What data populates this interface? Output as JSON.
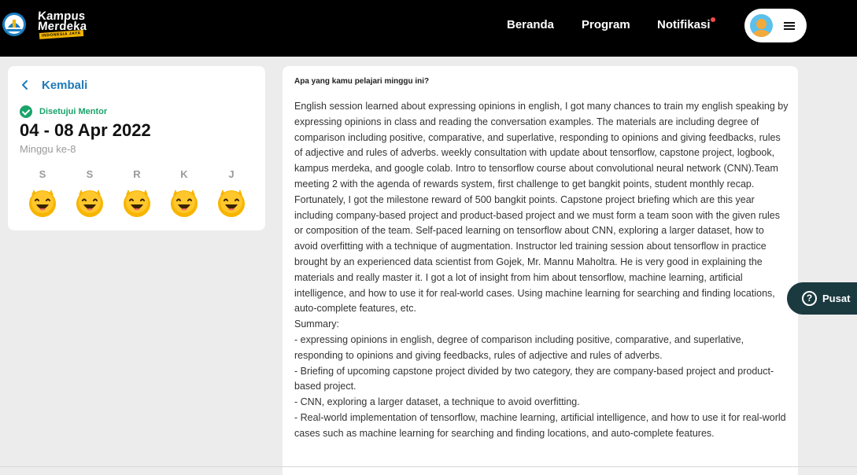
{
  "header": {
    "logo": {
      "word1": "Kampus",
      "word2": "Merdeka",
      "tagline": "INDONESIA JAYA"
    },
    "nav": {
      "beranda": "Beranda",
      "program": "Program",
      "notifikasi": "Notifikasi"
    },
    "colors": {
      "background": "#000000",
      "notif_dot": "#ff4a4a"
    }
  },
  "left_card": {
    "back_label": "Kembali",
    "status": "Disetujui Mentor",
    "date_range": "04 - 08 Apr 2022",
    "week": "Minggu ke-8",
    "days": [
      {
        "letter": "S",
        "mood": "very-happy-emoji"
      },
      {
        "letter": "S",
        "mood": "very-happy-emoji"
      },
      {
        "letter": "R",
        "mood": "very-happy-emoji"
      },
      {
        "letter": "K",
        "mood": "very-happy-emoji"
      },
      {
        "letter": "J",
        "mood": "very-happy-emoji"
      }
    ],
    "colors": {
      "accent": "#1f7bb6",
      "approved": "#1aa36a",
      "emoji": "#f7b500"
    }
  },
  "content": {
    "question": "Apa yang kamu pelajari minggu ini?",
    "paragraph": "English session learned about expressing opinions in english, I got many chances to train my english speaking by expressing opinions in class and reading the conversation examples. The materials are including degree of comparison including positive, comparative, and superlative, responding to opinions and giving feedbacks, rules of adjective and rules of adverbs. weekly consultation with update about tensorflow, capstone project, logbook, kampus merdeka, and google colab. Intro to tensorflow course about convolutional neural network (CNN).Team meeting 2 with the agenda of rewards system, first challenge to get bangkit points, student monthly recap. Fortunately, I got the milestone reward of 500 bangkit points. Capstone project briefing which are this year including company-based project and product-based project and we must form a team soon with the given rules or composition of the team. Self-paced learning on tensorflow about CNN, exploring a larger dataset, how to avoid overfitting with a technique of augmentation. Instructor led training session about tensorflow in practice brought by an experienced data scientist from Gojek, Mr. Mannu Maholtra. He is very good in explaining the materials and really master it. I got a lot of insight from him about tensorflow, machine learning, artificial intelligence, and how to use it for real-world cases. Using machine learning for searching and finding locations, auto-complete features, etc.",
    "summary_heading": "Summary:",
    "summary_items": [
      "-    expressing opinions in english, degree of comparison including positive, comparative, and superlative, responding to opinions and giving feedbacks, rules of adjective and rules of adverbs.",
      "-    Briefing of upcoming capstone project divided by two category, they are company-based project and product-based project.",
      "-    CNN, exploring a larger dataset, a technique to avoid overfitting.",
      "-    Real-world implementation of tensorflow, machine learning, artificial intelligence, and how to use it for real-world cases such as machine learning for searching and finding locations, and auto-complete features."
    ]
  },
  "help": {
    "label": "Pusat",
    "icon": "question-circle-icon",
    "color": "#1b3a40"
  }
}
